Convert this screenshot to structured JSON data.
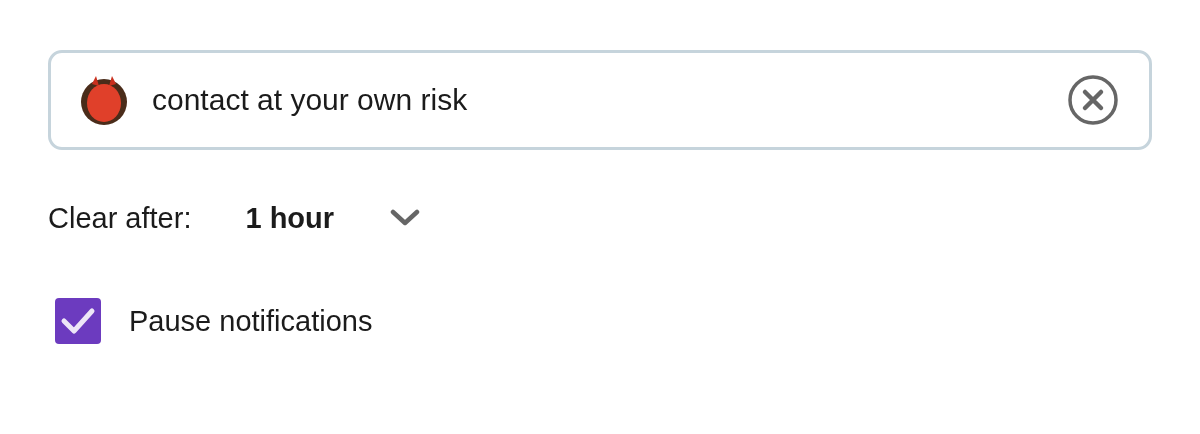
{
  "status_field": {
    "value": "contact at your own risk"
  },
  "clear_after": {
    "label": "Clear after:",
    "value": "1 hour"
  },
  "pause_notifications": {
    "label": "Pause notifications",
    "checked": true
  }
}
